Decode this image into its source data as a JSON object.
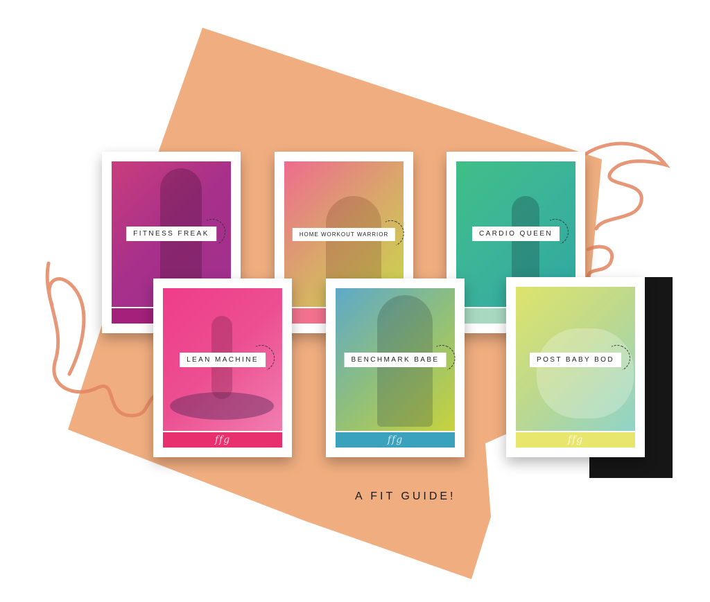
{
  "guides": [
    {
      "name": "FITNESS FREAK",
      "strip_color": "#a3217a",
      "grad_from": "#c93d7d",
      "grad_to": "#a1308f",
      "overlay_color": "#a6308a"
    },
    {
      "name": "HOME WORKOUT WARRIOR",
      "strip_color": "#f2728e",
      "grad_from": "#ee6b8f",
      "grad_to": "#c8d94a",
      "overlay_color": "#d9a86a"
    },
    {
      "name": "CARDIO QUEEN",
      "strip_color": "#a8d9c0",
      "grad_from": "#3fbf86",
      "grad_to": "#2ea7a0",
      "overlay_color": "#3bb39a"
    },
    {
      "name": "LEAN MACHINE",
      "strip_color": "#e8306f",
      "grad_from": "#ef3c8a",
      "grad_to": "#f07eb0",
      "overlay_color": "#ec4f91"
    },
    {
      "name": "BENCHMARK BABE",
      "strip_color": "#3aa2bd",
      "grad_from": "#5ea9c9",
      "grad_to": "#c8d23c",
      "overlay_color": "#8fbf7c"
    },
    {
      "name": "POST BABY BOD",
      "strip_color": "#e9e66e",
      "grad_from": "#dde46b",
      "grad_to": "#8fd4c9",
      "overlay_color": "#bcd88f"
    }
  ],
  "footer_text": "A FIT GUIDE!",
  "brand_mark": "ffg",
  "colors": {
    "backdrop": "#f0ae80",
    "squiggle": "#e2855f",
    "shadow_block": "#1a1a1a"
  }
}
